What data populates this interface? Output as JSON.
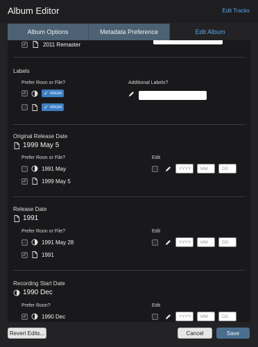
{
  "window": {
    "title": "Album Editor",
    "edit_tracks": "Edit Tracks"
  },
  "tabs": [
    {
      "label": "Album Options"
    },
    {
      "label": "Metadata Preference"
    },
    {
      "label": "Edit Album"
    }
  ],
  "remaster": {
    "label": "2011 Remaster"
  },
  "labels": {
    "title": "Labels",
    "prefer_heading": "Prefer Roon or File?",
    "additional_heading": "Additional Labels?",
    "rows": [
      {
        "tag": "VIRGIN"
      },
      {
        "tag": "VIRGIN"
      }
    ]
  },
  "original_release": {
    "title": "Original Release Date",
    "value": "1999 May 5",
    "prefer_heading": "Prefer Roon or File?",
    "edit_heading": "Edit",
    "roon_value": "1991 May",
    "file_value": "1999 May 5"
  },
  "release_date": {
    "title": "Release Date",
    "value": "1991",
    "prefer_heading": "Prefer Roon or File?",
    "edit_heading": "Edit",
    "roon_value": "1991 May 28",
    "file_value": "1991"
  },
  "recording_start": {
    "title": "Recording Start Date",
    "value": "1990 Dec",
    "prefer_heading": "Prefer Roon?",
    "edit_heading": "Edit",
    "roon_value": "1990 Dec"
  },
  "date_placeholders": {
    "year": "YYYY",
    "month": "MM",
    "day": "DD"
  },
  "footer": {
    "revert": "Revert Edits...",
    "cancel": "Cancel",
    "save": "Save"
  },
  "colors": {
    "accent": "#5aa5e6",
    "tab_bg": "#4c6274",
    "tag_bg": "#3d7fc6",
    "save_bg": "#4a6e8e"
  }
}
